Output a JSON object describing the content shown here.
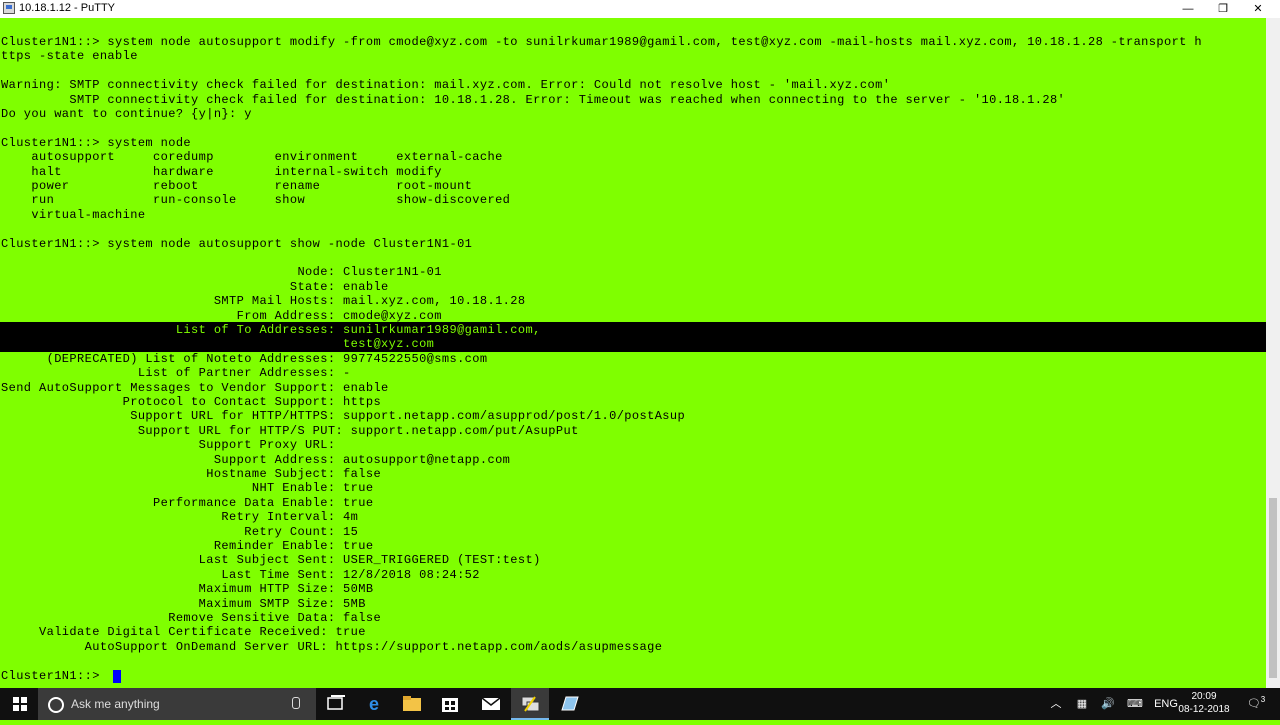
{
  "window": {
    "title": "10.18.1.12 - PuTTY",
    "minimize": "—",
    "restore": "❐",
    "close": "✕"
  },
  "colors": {
    "terminal_bg": "#7fff00",
    "terminal_fg": "#000000",
    "cursor": "#0000ff",
    "taskbar": "#101010"
  },
  "terminal": {
    "lines": [
      "Cluster1N1::> system node autosupport modify -from cmode@xyz.com -to sunilrkumar1989@gamil.com, test@xyz.com -mail-hosts mail.xyz.com, 10.18.1.28 -transport h",
      "ttps -state enable",
      "",
      "Warning: SMTP connectivity check failed for destination: mail.xyz.com. Error: Could not resolve host - 'mail.xyz.com'",
      "         SMTP connectivity check failed for destination: 10.18.1.28. Error: Timeout was reached when connecting to the server - '10.18.1.28'",
      "Do you want to continue? {y|n}: y",
      "",
      "Cluster1N1::> system node",
      "    autosupport     coredump        environment     external-cache",
      "    halt            hardware        internal-switch modify",
      "    power           reboot          rename          root-mount",
      "    run             run-console     show            show-discovered",
      "    virtual-machine",
      "",
      "Cluster1N1::> system node autosupport show -node Cluster1N1-01",
      "",
      "                                       Node: Cluster1N1-01",
      "                                      State: enable",
      "                            SMTP Mail Hosts: mail.xyz.com, 10.18.1.28",
      "                               From Address: cmode@xyz.com",
      "                       List of To Addresses: sunilrkumar1989@gamil.com,",
      "                                             test@xyz.com",
      "      (DEPRECATED) List of Noteto Addresses: 99774522550@sms.com",
      "                  List of Partner Addresses: -",
      "Send AutoSupport Messages to Vendor Support: enable",
      "                Protocol to Contact Support: https",
      "                 Support URL for HTTP/HTTPS: support.netapp.com/asupprod/post/1.0/postAsup",
      "                  Support URL for HTTP/S PUT: support.netapp.com/put/AsupPut",
      "                          Support Proxy URL:",
      "                            Support Address: autosupport@netapp.com",
      "                           Hostname Subject: false",
      "                                 NHT Enable: true",
      "                    Performance Data Enable: true",
      "                             Retry Interval: 4m",
      "                                Retry Count: 15",
      "                            Reminder Enable: true",
      "                          Last Subject Sent: USER_TRIGGERED (TEST:test)",
      "                             Last Time Sent: 12/8/2018 08:24:52",
      "                          Maximum HTTP Size: 50MB",
      "                          Maximum SMTP Size: 5MB",
      "                      Remove Sensitive Data: false",
      "     Validate Digital Certificate Received: true",
      "           AutoSupport OnDemand Server URL: https://support.netapp.com/aods/asupmessage",
      "",
      "Cluster1N1::> "
    ],
    "highlight_line_indices": [
      20,
      21
    ]
  },
  "taskbar": {
    "search_placeholder": "Ask me anything",
    "language": "ENG",
    "time": "20:09",
    "date": "08-12-2018",
    "notification_count": "3",
    "icons": [
      "task-view-icon",
      "edge-icon",
      "file-explorer-icon",
      "store-icon",
      "mail-icon",
      "putty-icon",
      "notepad-icon"
    ]
  }
}
